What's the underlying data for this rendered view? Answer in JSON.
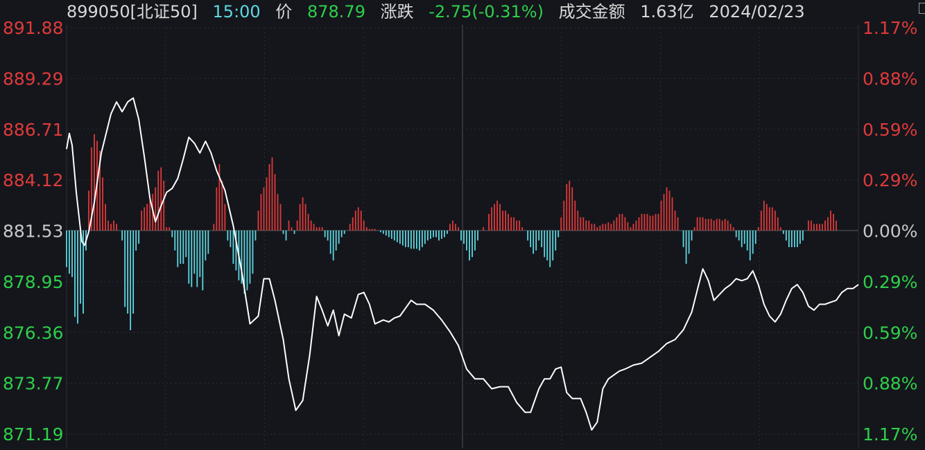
{
  "header": {
    "code_name": "899050[北证50]",
    "time": "15:00",
    "price_label": "价",
    "price": "878.79",
    "change_label": "涨跌",
    "change": "-2.75(-0.31%)",
    "turnover_label": "成交金额",
    "turnover": "1.63亿",
    "date": "2024/02/23"
  },
  "colors": {
    "background": "#14161c",
    "up": "#e03a3a",
    "down": "#2fcf4a",
    "neutral": "#c8c8c8",
    "price_line": "#ffffff",
    "up_bar": "#e03a3a",
    "down_bar": "#5ed8e2",
    "grid": "#2c2f36"
  },
  "chart_data": {
    "type": "line",
    "prev_close": 881.53,
    "ylim": [
      871.19,
      891.88
    ],
    "left_ticks": [
      "891.88",
      "889.29",
      "886.71",
      "884.12",
      "881.53",
      "878.95",
      "876.36",
      "873.77",
      "871.19"
    ],
    "right_ticks": [
      "1.17%",
      "0.88%",
      "0.59%",
      "0.29%",
      "0.00%",
      "0.29%",
      "0.59%",
      "0.88%",
      "1.17%"
    ],
    "grid": true,
    "price_series": [
      [
        0,
        885.7
      ],
      [
        2,
        886.5
      ],
      [
        4,
        885.9
      ],
      [
        7,
        883.5
      ],
      [
        11,
        881.0
      ],
      [
        13,
        880.8
      ],
      [
        16,
        881.5
      ],
      [
        20,
        883.0
      ],
      [
        25,
        885.5
      ],
      [
        32,
        887.5
      ],
      [
        36,
        888.1
      ],
      [
        40,
        887.6
      ],
      [
        44,
        888.1
      ],
      [
        48,
        888.3
      ],
      [
        52,
        887.2
      ],
      [
        56,
        885.3
      ],
      [
        60,
        883.2
      ],
      [
        64,
        882.0
      ],
      [
        68,
        882.8
      ],
      [
        72,
        883.5
      ],
      [
        76,
        883.7
      ],
      [
        80,
        884.2
      ],
      [
        84,
        885.2
      ],
      [
        88,
        886.3
      ],
      [
        92,
        886.0
      ],
      [
        96,
        885.5
      ],
      [
        100,
        886.1
      ],
      [
        104,
        885.5
      ],
      [
        108,
        884.6
      ],
      [
        114,
        883.6
      ],
      [
        120,
        881.8
      ],
      [
        126,
        879.5
      ],
      [
        132,
        876.8
      ],
      [
        138,
        877.2
      ],
      [
        142,
        879.1
      ],
      [
        146,
        879.1
      ],
      [
        150,
        878.0
      ],
      [
        156,
        876.0
      ],
      [
        160,
        874.0
      ],
      [
        165,
        872.4
      ],
      [
        170,
        872.9
      ],
      [
        175,
        875.2
      ],
      [
        180,
        878.2
      ],
      [
        184,
        877.5
      ],
      [
        188,
        876.7
      ],
      [
        192,
        877.5
      ],
      [
        196,
        876.2
      ],
      [
        200,
        877.3
      ],
      [
        205,
        877.1
      ],
      [
        210,
        878.3
      ],
      [
        214,
        878.4
      ],
      [
        218,
        877.8
      ],
      [
        222,
        876.8
      ],
      [
        228,
        877.0
      ],
      [
        232,
        876.9
      ],
      [
        236,
        877.1
      ],
      [
        240,
        877.2
      ],
      [
        244,
        877.6
      ],
      [
        248,
        878.0
      ],
      [
        252,
        877.8
      ],
      [
        258,
        877.8
      ],
      [
        264,
        877.5
      ],
      [
        270,
        877.0
      ],
      [
        276,
        876.4
      ],
      [
        282,
        875.7
      ],
      [
        288,
        874.5
      ],
      [
        294,
        874.0
      ],
      [
        300,
        874.0
      ],
      [
        306,
        873.5
      ],
      [
        312,
        873.6
      ],
      [
        318,
        873.6
      ],
      [
        324,
        872.8
      ],
      [
        330,
        872.3
      ],
      [
        334,
        872.3
      ],
      [
        340,
        873.5
      ],
      [
        344,
        874.0
      ],
      [
        348,
        874.0
      ],
      [
        352,
        874.5
      ],
      [
        356,
        874.6
      ],
      [
        360,
        873.3
      ],
      [
        364,
        873.0
      ],
      [
        370,
        873.0
      ],
      [
        374,
        872.3
      ],
      [
        378,
        871.4
      ],
      [
        382,
        871.8
      ],
      [
        386,
        873.5
      ],
      [
        390,
        874.0
      ],
      [
        394,
        874.2
      ],
      [
        398,
        874.4
      ],
      [
        402,
        874.5
      ],
      [
        408,
        874.7
      ],
      [
        414,
        874.8
      ],
      [
        420,
        875.1
      ],
      [
        426,
        875.4
      ],
      [
        432,
        875.8
      ],
      [
        438,
        876.0
      ],
      [
        444,
        876.5
      ],
      [
        450,
        877.4
      ],
      [
        455,
        878.8
      ],
      [
        458,
        879.6
      ],
      [
        462,
        879.0
      ],
      [
        466,
        878.0
      ],
      [
        470,
        878.3
      ],
      [
        474,
        878.6
      ],
      [
        478,
        878.8
      ],
      [
        482,
        879.1
      ],
      [
        486,
        879.0
      ],
      [
        490,
        879.1
      ],
      [
        494,
        879.5
      ],
      [
        498,
        878.8
      ],
      [
        502,
        877.8
      ],
      [
        506,
        877.2
      ],
      [
        510,
        876.9
      ],
      [
        514,
        877.3
      ],
      [
        518,
        878.0
      ],
      [
        522,
        878.6
      ],
      [
        526,
        878.8
      ],
      [
        530,
        878.4
      ],
      [
        534,
        877.7
      ],
      [
        538,
        877.5
      ],
      [
        542,
        877.8
      ],
      [
        546,
        877.8
      ],
      [
        550,
        877.9
      ],
      [
        554,
        878.0
      ],
      [
        558,
        878.4
      ],
      [
        562,
        878.6
      ],
      [
        566,
        878.6
      ],
      [
        570,
        878.8
      ]
    ],
    "volume_series": [
      [
        0,
        -1.1
      ],
      [
        2,
        -1.3
      ],
      [
        4,
        -1.4
      ],
      [
        6,
        -2.6
      ],
      [
        8,
        -2.8
      ],
      [
        10,
        -2.2
      ],
      [
        12,
        -2.5
      ],
      [
        14,
        -0.6
      ],
      [
        16,
        1.2
      ],
      [
        18,
        2.5
      ],
      [
        20,
        2.9
      ],
      [
        22,
        2.7
      ],
      [
        24,
        2.4
      ],
      [
        26,
        1.6
      ],
      [
        28,
        0.8
      ],
      [
        30,
        0.3
      ],
      [
        32,
        0.2
      ],
      [
        34,
        0.3
      ],
      [
        36,
        0.2
      ],
      [
        40,
        -0.3
      ],
      [
        42,
        -2.3
      ],
      [
        44,
        -2.5
      ],
      [
        46,
        -3.0
      ],
      [
        48,
        -2.5
      ],
      [
        50,
        -0.6
      ],
      [
        52,
        -0.4
      ],
      [
        54,
        0.6
      ],
      [
        56,
        0.7
      ],
      [
        58,
        0.8
      ],
      [
        60,
        0.9
      ],
      [
        62,
        1.1
      ],
      [
        64,
        1.3
      ],
      [
        66,
        1.8
      ],
      [
        68,
        1.9
      ],
      [
        70,
        1.5
      ],
      [
        72,
        0.1
      ],
      [
        74,
        0.1
      ],
      [
        76,
        -0.2
      ],
      [
        78,
        -0.6
      ],
      [
        80,
        -1.1
      ],
      [
        82,
        -1.0
      ],
      [
        84,
        -1.0
      ],
      [
        86,
        -0.8
      ],
      [
        88,
        -1.6
      ],
      [
        90,
        -1.7
      ],
      [
        92,
        -1.3
      ],
      [
        94,
        -1.7
      ],
      [
        96,
        -1.4
      ],
      [
        98,
        -1.8
      ],
      [
        100,
        -0.9
      ],
      [
        102,
        -0.7
      ],
      [
        106,
        0.2
      ],
      [
        108,
        1.3
      ],
      [
        110,
        2.0
      ],
      [
        112,
        1.5
      ],
      [
        114,
        0.8
      ],
      [
        116,
        -0.3
      ],
      [
        118,
        -0.5
      ],
      [
        120,
        -1.0
      ],
      [
        122,
        -1.2
      ],
      [
        124,
        -1.5
      ],
      [
        126,
        -1.6
      ],
      [
        128,
        -1.9
      ],
      [
        130,
        -1.8
      ],
      [
        132,
        -1.6
      ],
      [
        134,
        -1.3
      ],
      [
        136,
        -0.3
      ],
      [
        138,
        0.6
      ],
      [
        140,
        1.1
      ],
      [
        142,
        1.3
      ],
      [
        144,
        1.6
      ],
      [
        146,
        2.0
      ],
      [
        148,
        2.2
      ],
      [
        150,
        1.7
      ],
      [
        152,
        1.1
      ],
      [
        154,
        0.8
      ],
      [
        156,
        -0.1
      ],
      [
        158,
        -0.3
      ],
      [
        160,
        0.3
      ],
      [
        162,
        0.1
      ],
      [
        164,
        -0.1
      ],
      [
        166,
        0.3
      ],
      [
        168,
        0.8
      ],
      [
        170,
        1.0
      ],
      [
        172,
        0.8
      ],
      [
        174,
        0.5
      ],
      [
        176,
        0.3
      ],
      [
        178,
        0.2
      ],
      [
        180,
        0.1
      ],
      [
        182,
        0.1
      ],
      [
        184,
        0.1
      ],
      [
        186,
        -0.2
      ],
      [
        188,
        -0.3
      ],
      [
        190,
        -0.7
      ],
      [
        192,
        -0.9
      ],
      [
        194,
        -0.6
      ],
      [
        196,
        -0.4
      ],
      [
        198,
        -0.2
      ],
      [
        200,
        -0.1
      ],
      [
        202,
        0.0
      ],
      [
        204,
        0.2
      ],
      [
        206,
        0.4
      ],
      [
        208,
        0.6
      ],
      [
        210,
        0.7
      ],
      [
        212,
        0.6
      ],
      [
        214,
        0.3
      ],
      [
        216,
        0.1
      ],
      [
        218,
        0.05
      ],
      [
        220,
        0.05
      ],
      [
        222,
        0.05
      ],
      [
        226,
        -0.05
      ],
      [
        228,
        -0.1
      ],
      [
        230,
        -0.15
      ],
      [
        232,
        -0.2
      ],
      [
        234,
        -0.25
      ],
      [
        236,
        -0.3
      ],
      [
        238,
        -0.35
      ],
      [
        240,
        -0.4
      ],
      [
        242,
        -0.45
      ],
      [
        244,
        -0.5
      ],
      [
        246,
        -0.5
      ],
      [
        248,
        -0.55
      ],
      [
        250,
        -0.55
      ],
      [
        252,
        -0.55
      ],
      [
        254,
        -0.6
      ],
      [
        256,
        -0.5
      ],
      [
        258,
        -0.4
      ],
      [
        260,
        -0.3
      ],
      [
        262,
        -0.25
      ],
      [
        264,
        -0.2
      ],
      [
        266,
        -0.2
      ],
      [
        268,
        -0.3
      ],
      [
        270,
        -0.25
      ],
      [
        272,
        -0.2
      ],
      [
        274,
        -0.1
      ],
      [
        276,
        0.2
      ],
      [
        278,
        0.3
      ],
      [
        280,
        0.2
      ],
      [
        282,
        0.1
      ],
      [
        284,
        -0.3
      ],
      [
        286,
        -0.4
      ],
      [
        288,
        -0.6
      ],
      [
        290,
        -0.9
      ],
      [
        292,
        -0.8
      ],
      [
        294,
        -0.6
      ],
      [
        296,
        -0.3
      ],
      [
        298,
        0.0
      ],
      [
        300,
        0.1
      ],
      [
        304,
        0.5
      ],
      [
        306,
        0.7
      ],
      [
        308,
        0.8
      ],
      [
        310,
        0.9
      ],
      [
        312,
        0.8
      ],
      [
        314,
        0.6
      ],
      [
        316,
        0.6
      ],
      [
        318,
        0.5
      ],
      [
        320,
        0.4
      ],
      [
        322,
        0.4
      ],
      [
        324,
        0.3
      ],
      [
        326,
        0.3
      ],
      [
        328,
        0.1
      ],
      [
        330,
        0.0
      ],
      [
        332,
        -0.3
      ],
      [
        334,
        -0.5
      ],
      [
        336,
        -0.7
      ],
      [
        338,
        -0.6
      ],
      [
        340,
        -0.3
      ],
      [
        342,
        -0.5
      ],
      [
        344,
        -0.8
      ],
      [
        346,
        -0.9
      ],
      [
        348,
        -1.1
      ],
      [
        350,
        -0.9
      ],
      [
        352,
        -0.6
      ],
      [
        354,
        -0.2
      ],
      [
        356,
        0.4
      ],
      [
        358,
        0.9
      ],
      [
        360,
        1.4
      ],
      [
        362,
        1.5
      ],
      [
        364,
        1.3
      ],
      [
        366,
        0.9
      ],
      [
        368,
        0.6
      ],
      [
        370,
        0.4
      ],
      [
        372,
        0.4
      ],
      [
        374,
        0.3
      ],
      [
        376,
        0.3
      ],
      [
        378,
        0.2
      ],
      [
        380,
        0.2
      ],
      [
        382,
        0.1
      ],
      [
        384,
        0.15
      ],
      [
        386,
        0.2
      ],
      [
        388,
        0.2
      ],
      [
        390,
        0.25
      ],
      [
        392,
        0.2
      ],
      [
        394,
        0.3
      ],
      [
        396,
        0.4
      ],
      [
        398,
        0.5
      ],
      [
        400,
        0.5
      ],
      [
        402,
        0.4
      ],
      [
        404,
        0.25
      ],
      [
        406,
        0.1
      ],
      [
        408,
        0.2
      ],
      [
        410,
        0.3
      ],
      [
        412,
        0.4
      ],
      [
        414,
        0.5
      ],
      [
        416,
        0.5
      ],
      [
        418,
        0.5
      ],
      [
        420,
        0.45
      ],
      [
        422,
        0.45
      ],
      [
        424,
        0.5
      ],
      [
        426,
        0.5
      ],
      [
        428,
        0.9
      ],
      [
        430,
        1.1
      ],
      [
        432,
        1.3
      ],
      [
        434,
        1.2
      ],
      [
        436,
        1.0
      ],
      [
        438,
        0.6
      ],
      [
        440,
        0.4
      ],
      [
        442,
        0.0
      ],
      [
        444,
        -0.5
      ],
      [
        446,
        -1.0
      ],
      [
        448,
        -0.7
      ],
      [
        450,
        -0.3
      ],
      [
        452,
        0.1
      ],
      [
        454,
        0.4
      ],
      [
        456,
        0.4
      ],
      [
        458,
        0.4
      ],
      [
        460,
        0.35
      ],
      [
        462,
        0.35
      ],
      [
        464,
        0.35
      ],
      [
        466,
        0.3
      ],
      [
        468,
        0.35
      ],
      [
        470,
        0.35
      ],
      [
        472,
        0.3
      ],
      [
        474,
        0.35
      ],
      [
        476,
        0.3
      ],
      [
        478,
        0.2
      ],
      [
        480,
        0.1
      ],
      [
        482,
        -0.2
      ],
      [
        484,
        -0.3
      ],
      [
        486,
        -0.5
      ],
      [
        488,
        -0.4
      ],
      [
        490,
        -0.6
      ],
      [
        492,
        -0.9
      ],
      [
        494,
        -0.7
      ],
      [
        496,
        -0.4
      ],
      [
        498,
        0.1
      ],
      [
        500,
        0.6
      ],
      [
        502,
        0.9
      ],
      [
        504,
        0.8
      ],
      [
        506,
        0.7
      ],
      [
        508,
        0.7
      ],
      [
        510,
        0.6
      ],
      [
        512,
        0.4
      ],
      [
        514,
        0.1
      ],
      [
        516,
        -0.1
      ],
      [
        518,
        -0.3
      ],
      [
        520,
        -0.5
      ],
      [
        522,
        -0.5
      ],
      [
        524,
        -0.5
      ],
      [
        526,
        -0.5
      ],
      [
        528,
        -0.4
      ],
      [
        530,
        -0.3
      ],
      [
        532,
        0.0
      ],
      [
        534,
        0.3
      ],
      [
        536,
        0.3
      ],
      [
        538,
        0.2
      ],
      [
        540,
        0.2
      ],
      [
        542,
        0.2
      ],
      [
        544,
        0.2
      ],
      [
        546,
        0.3
      ],
      [
        548,
        0.4
      ],
      [
        550,
        0.6
      ],
      [
        552,
        0.5
      ],
      [
        554,
        0.3
      ]
    ]
  }
}
